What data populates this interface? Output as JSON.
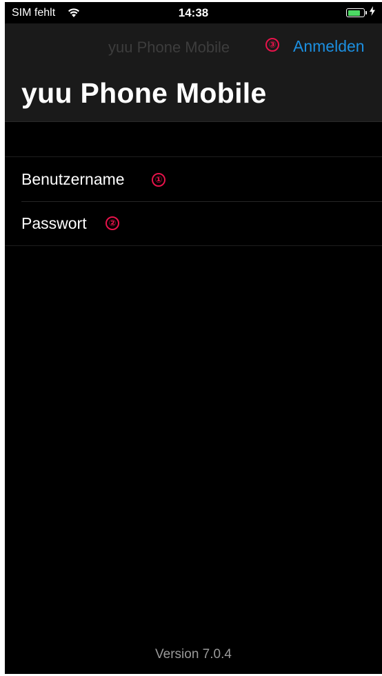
{
  "status_bar": {
    "carrier": "SIM fehlt",
    "time": "14:38",
    "battery_level": 0.85,
    "battery_color": "#4cd964",
    "icons": [
      "wifi-icon",
      "battery-icon",
      "charging-bolt-icon"
    ]
  },
  "nav_bar": {
    "small_title": "yuu Phone Mobile",
    "signin_label": "Anmelden",
    "signin_marker": "③",
    "large_title": "yuu Phone Mobile"
  },
  "form": {
    "username": {
      "value": "",
      "placeholder": "Benutzername",
      "marker": "①"
    },
    "password": {
      "value": "",
      "placeholder": "Passwort",
      "marker": "②"
    }
  },
  "footer": {
    "version": "Version 7.0.4"
  },
  "colors": {
    "accent": "#1c8fe0",
    "marker": "#e8134b",
    "background": "#000000",
    "nav_background": "#1a1a1a"
  }
}
